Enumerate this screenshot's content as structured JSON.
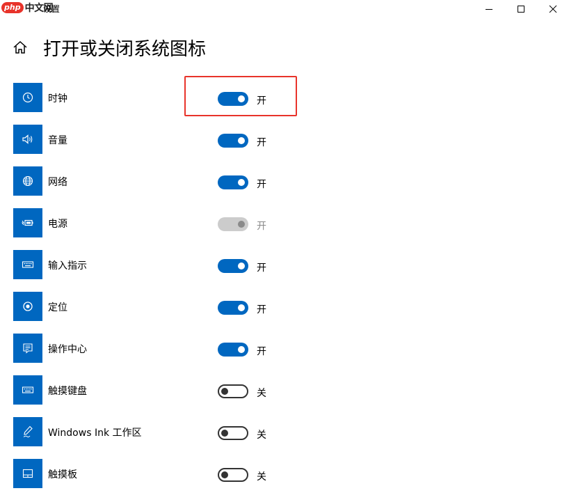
{
  "watermark": {
    "logo": "php",
    "text": "中文网"
  },
  "window": {
    "title": "设置"
  },
  "header": {
    "title": "打开或关闭系统图标"
  },
  "items": [
    {
      "label": "时钟",
      "state": "开",
      "on": true,
      "disabled": false,
      "icon": "clock-icon"
    },
    {
      "label": "音量",
      "state": "开",
      "on": true,
      "disabled": false,
      "icon": "volume-icon"
    },
    {
      "label": "网络",
      "state": "开",
      "on": true,
      "disabled": false,
      "icon": "globe-icon"
    },
    {
      "label": "电源",
      "state": "开",
      "on": true,
      "disabled": true,
      "icon": "battery-icon"
    },
    {
      "label": "输入指示",
      "state": "开",
      "on": true,
      "disabled": false,
      "icon": "keyboard-icon"
    },
    {
      "label": "定位",
      "state": "开",
      "on": true,
      "disabled": false,
      "icon": "location-icon"
    },
    {
      "label": "操作中心",
      "state": "开",
      "on": true,
      "disabled": false,
      "icon": "action-center-icon"
    },
    {
      "label": "触摸键盘",
      "state": "关",
      "on": false,
      "disabled": false,
      "icon": "keyboard-icon"
    },
    {
      "label": "Windows Ink 工作区",
      "state": "关",
      "on": false,
      "disabled": false,
      "icon": "pen-icon"
    },
    {
      "label": "触摸板",
      "state": "关",
      "on": false,
      "disabled": false,
      "icon": "touchpad-icon"
    }
  ],
  "colors": {
    "accent": "#0067c0",
    "highlight": "#e8332a",
    "disabled": "#cccccc"
  }
}
